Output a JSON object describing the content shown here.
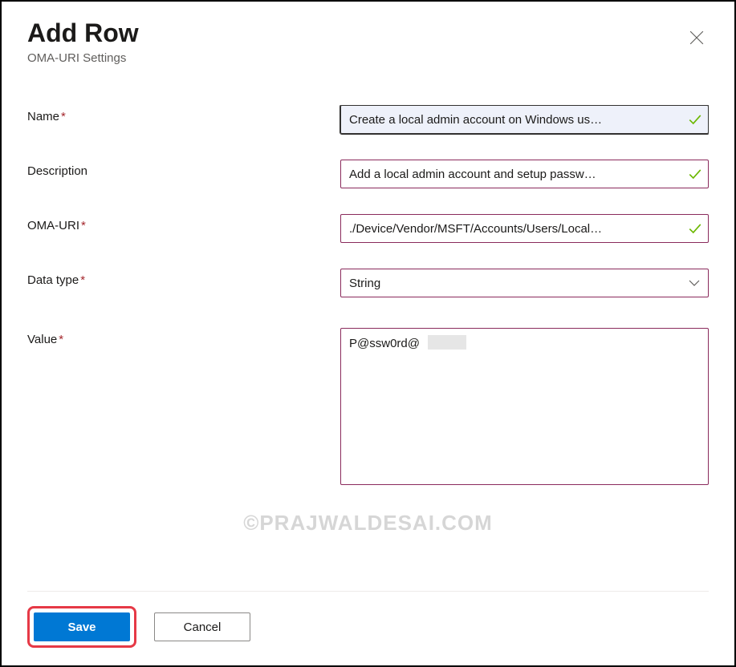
{
  "header": {
    "title": "Add Row",
    "subtitle": "OMA-URI Settings"
  },
  "form": {
    "name": {
      "label": "Name",
      "required": true,
      "value": "Create a local admin account on Windows us…",
      "validated": true
    },
    "description": {
      "label": "Description",
      "required": false,
      "value": "Add a local admin account and setup passw…",
      "validated": true
    },
    "oma_uri": {
      "label": "OMA-URI",
      "required": true,
      "value": "./Device/Vendor/MSFT/Accounts/Users/Local…",
      "validated": true
    },
    "data_type": {
      "label": "Data type",
      "required": true,
      "selected": "String"
    },
    "value": {
      "label": "Value",
      "required": true,
      "text": "P@ssw0rd@"
    }
  },
  "footer": {
    "save_label": "Save",
    "cancel_label": "Cancel"
  },
  "watermark": "©PRAJWALDESAI.COM"
}
